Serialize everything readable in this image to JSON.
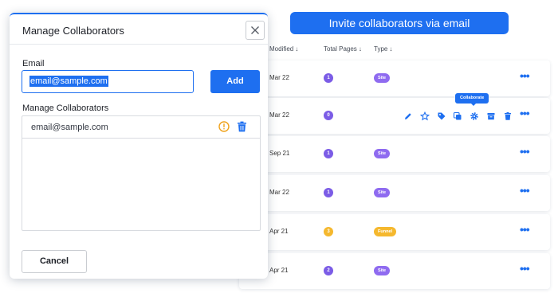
{
  "banner": {
    "text": "Invite collaborators via email"
  },
  "table": {
    "headers": {
      "modified": "Modified",
      "total_pages": "Total Pages",
      "type": "Type"
    },
    "rows": [
      {
        "date": "Mar 22",
        "pages": "1",
        "type": "Site"
      },
      {
        "date": "Mar 22",
        "pages": "0",
        "type": ""
      },
      {
        "date": "Sep 21",
        "pages": "1",
        "type": "Site"
      },
      {
        "date": "Mar 22",
        "pages": "1",
        "type": "Site"
      },
      {
        "date": "Apr 21",
        "pages": "3",
        "type": "Funnel"
      },
      {
        "date": "Apr 21",
        "pages": "2",
        "type": "Site"
      }
    ],
    "tooltip": "Collaborate",
    "colors": {
      "purple": "#7b5ce6",
      "yellow": "#f5b82e",
      "blue": "#1e6ff0"
    }
  },
  "modal": {
    "title": "Manage Collaborators",
    "email_label": "Email",
    "email_value": "email@sample.com",
    "add_label": "Add",
    "list_label": "Manage Collaborators",
    "collaborators": [
      {
        "email": "email@sample.com"
      }
    ],
    "cancel_label": "Cancel"
  }
}
